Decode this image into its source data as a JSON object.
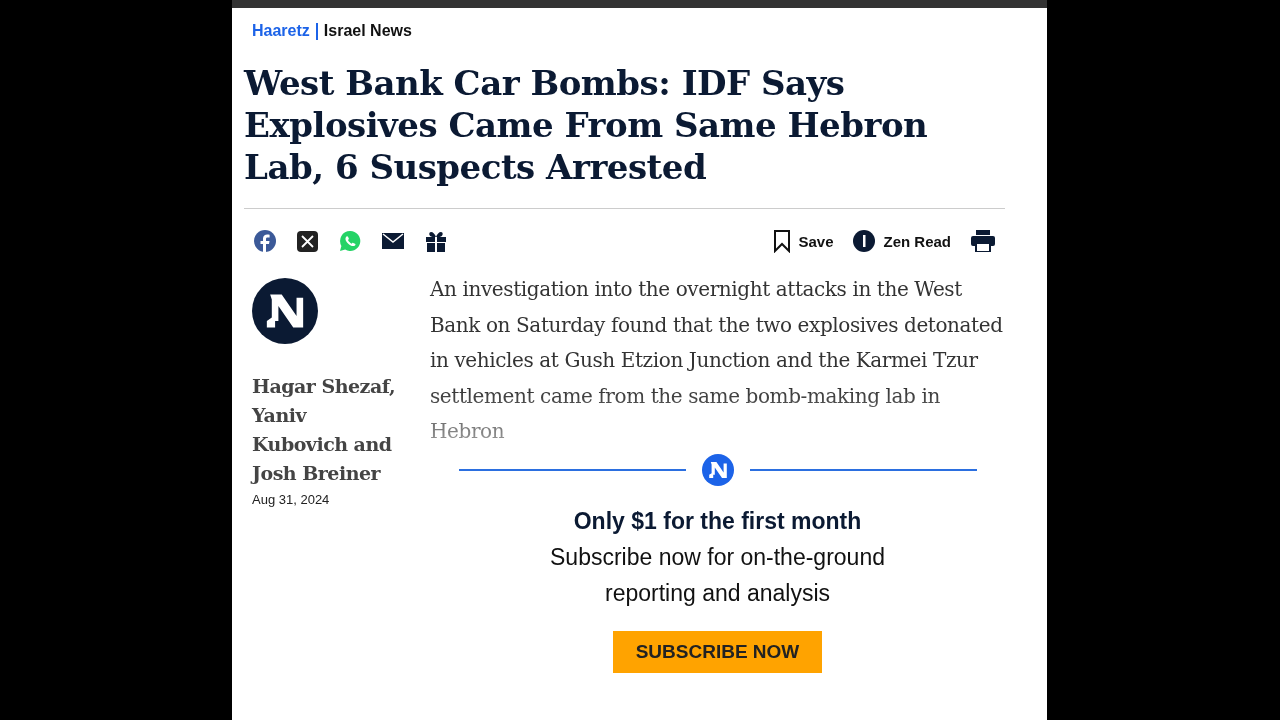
{
  "header": {
    "brand": "Haaretz",
    "section": "Israel News"
  },
  "headline": "West Bank Car Bombs: IDF Says Explosives Came From Same Hebron Lab, 6 Suspects Arrested",
  "share": [
    {
      "kind": "facebook"
    },
    {
      "kind": "x"
    },
    {
      "kind": "whatsapp"
    },
    {
      "kind": "email"
    },
    {
      "kind": "gift"
    }
  ],
  "actions": [
    {
      "kind": "save",
      "label": "Save"
    },
    {
      "kind": "zen",
      "label": "Zen Read"
    },
    {
      "kind": "print"
    }
  ],
  "byline": {
    "authors": "Hagar Shezaf, Yaniv Kubovich and Josh Breiner",
    "date": "Aug 31, 2024"
  },
  "article": {
    "paragraph": "An investigation into the overnight attacks in the West Bank on Saturday found that the two explosives detonated in vehicles at Gush Etzion Junction and the Karmei Tzur settlement came from the same bomb-making lab in Hebron"
  },
  "paywall": {
    "title": "Only $1 for the first month",
    "subtitle": "Subscribe now for on-the-ground reporting and analysis",
    "button": "SUBSCRIBE NOW"
  }
}
